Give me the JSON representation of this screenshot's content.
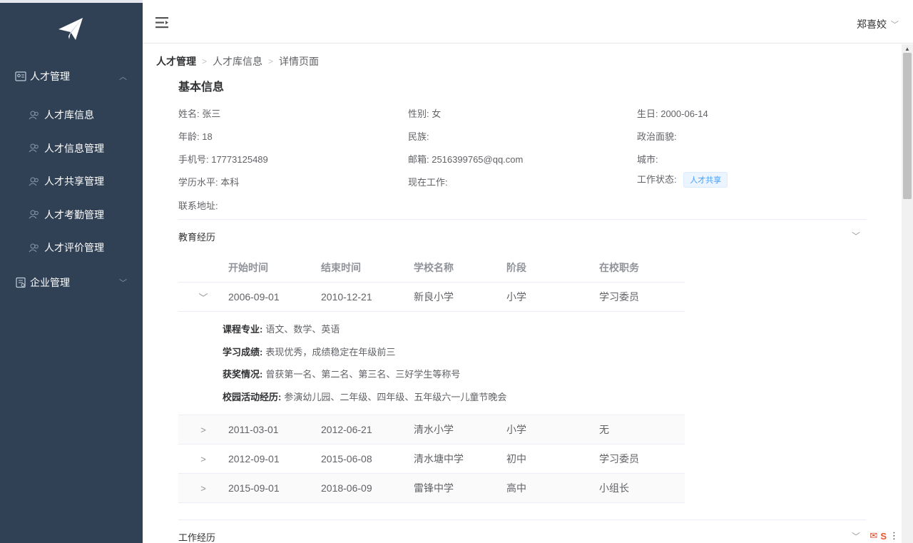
{
  "sidebar": {
    "logo_icon": "paper-plane-icon",
    "groups": [
      {
        "label": "人才管理",
        "expanded": true,
        "items": [
          {
            "label": "人才库信息"
          },
          {
            "label": "人才信息管理"
          },
          {
            "label": "人才共享管理"
          },
          {
            "label": "人才考勤管理"
          },
          {
            "label": "人才评价管理"
          }
        ]
      },
      {
        "label": "企业管理",
        "expanded": false,
        "items": []
      }
    ]
  },
  "header": {
    "user_name": "郑喜姣"
  },
  "breadcrumb": [
    "人才管理",
    "人才库信息",
    "详情页面"
  ],
  "basic_info": {
    "title": "基本信息",
    "name": "姓名: 张三",
    "gender": "性别: 女",
    "birthday": "生日: 2000-06-14",
    "age": "年龄: 18",
    "ethnicity": "民族:",
    "political": "政治面貌:",
    "phone": "手机号: 17773125489",
    "email": "邮箱: 2516399765@qq.com",
    "city": "城市:",
    "education": "学历水平: 本科",
    "current_job": "现在工作:",
    "work_status_label": "工作状态:",
    "work_status_tag": "人才共享",
    "address": "联系地址:"
  },
  "education": {
    "title": "教育经历",
    "columns": [
      "开始时间",
      "结束时间",
      "学校名称",
      "阶段",
      "在校职务"
    ],
    "rows": [
      {
        "start": "2006-09-01",
        "end": "2010-12-21",
        "school": "新良小学",
        "stage": "小学",
        "role": "学习委员",
        "expanded": true
      },
      {
        "start": "2011-03-01",
        "end": "2012-06-21",
        "school": "清水小学",
        "stage": "小学",
        "role": "无",
        "expanded": false
      },
      {
        "start": "2012-09-01",
        "end": "2015-06-08",
        "school": "清水塘中学",
        "stage": "初中",
        "role": "学习委员",
        "expanded": false
      },
      {
        "start": "2015-09-01",
        "end": "2018-06-09",
        "school": "雷锋中学",
        "stage": "高中",
        "role": "小组长",
        "expanded": false
      }
    ],
    "detail": {
      "course_label": "课程专业:",
      "course": "语文、数学、英语",
      "grade_label": "学习成绩:",
      "grade": "表现优秀，成绩稳定在年级前三",
      "award_label": "获奖情况:",
      "award": "曾获第一名、第二名、第三名、三好学生等称号",
      "activity_label": "校园活动经历:",
      "activity": "参演幼儿园、二年级、四年级、五年级六一儿童节晚会"
    }
  },
  "work": {
    "title": "工作经历"
  },
  "colors": {
    "sidebar_bg": "#304156",
    "tag_color": "#409eff"
  }
}
